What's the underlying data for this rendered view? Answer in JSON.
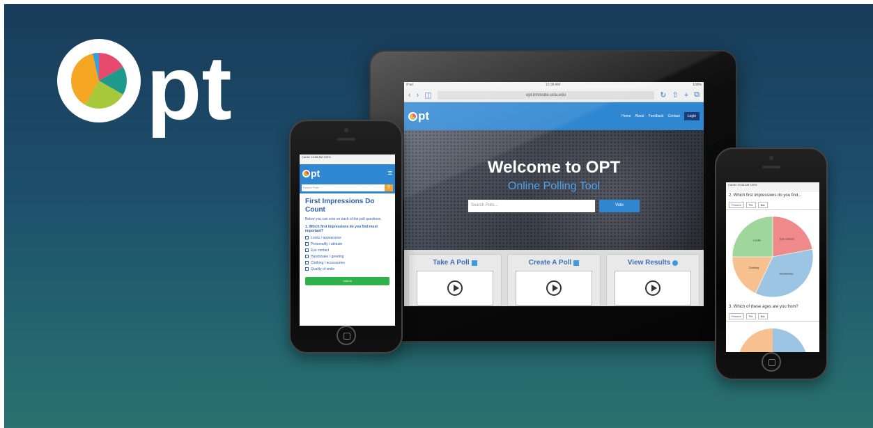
{
  "brand": {
    "logo_text": "pt",
    "pie_colors": [
      "#f5a623",
      "#e84a6f",
      "#1f9a8a",
      "#a7c83a",
      "#3aa0d8"
    ]
  },
  "tablet": {
    "status_left": "iPad",
    "status_center": "10:38 AM",
    "status_right": "100%",
    "url": "opt.innovate.ucla.edu",
    "nav_brand": "pt",
    "nav_links": [
      "Home",
      "About",
      "Feedback",
      "Contact"
    ],
    "login_label": "Login",
    "hero_title": "Welcome to OPT",
    "hero_subtitle": "Online Polling Tool",
    "search_placeholder": "Search Polls...",
    "search_button": "Vote",
    "cards": [
      {
        "title": "Take A Poll",
        "icon": "list-icon"
      },
      {
        "title": "Create A Poll",
        "icon": "edit-icon"
      },
      {
        "title": "View Results",
        "icon": "clock-icon"
      }
    ]
  },
  "phone_left": {
    "status_left": "Carrier",
    "status_center": "10:38 AM",
    "status_right": "100%",
    "brand": "pt",
    "search_placeholder": "Search Polls",
    "poll_title": "First Impressions Do Count",
    "poll_intro": "Below you can vote on each of the poll questions.",
    "poll_question": "1. Which first impressions do you find most important?",
    "options": [
      "Looks / appearance",
      "Personality / attitude",
      "Eye contact",
      "Handshake / greeting",
      "Clothing / accessories",
      "Quality of smile"
    ],
    "submit_label": "Submit"
  },
  "phone_right": {
    "status_left": "Carrier",
    "status_center": "10:38 AM",
    "status_right": "100%",
    "question_1": "2. Which first impressions do you find...",
    "question_2": "3. Which of these ages are you from?",
    "filters": [
      "Percent",
      "Pie",
      "Bar"
    ],
    "pie_labels": [
      "Eye contact",
      "Handshake",
      "Clothing",
      "Looks"
    ],
    "pie_values": [
      22,
      35,
      18,
      25
    ],
    "pie_colors": [
      "#ee8a8a",
      "#9cc5e3",
      "#f7c08f",
      "#9fd69b"
    ]
  }
}
